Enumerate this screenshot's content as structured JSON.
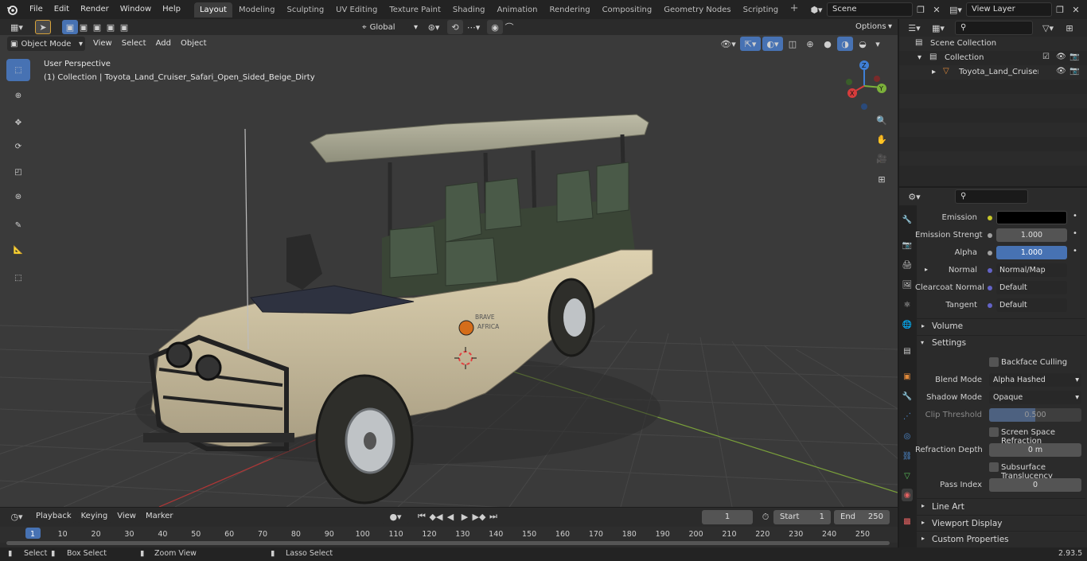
{
  "app": {
    "logo": "blender-logo-icon",
    "version": "2.93.5"
  },
  "menus": [
    "File",
    "Edit",
    "Render",
    "Window",
    "Help"
  ],
  "workspaces": [
    {
      "label": "Layout",
      "active": true
    },
    {
      "label": "Modeling"
    },
    {
      "label": "Sculpting"
    },
    {
      "label": "UV Editing"
    },
    {
      "label": "Texture Paint"
    },
    {
      "label": "Shading"
    },
    {
      "label": "Animation"
    },
    {
      "label": "Rendering"
    },
    {
      "label": "Compositing"
    },
    {
      "label": "Geometry Nodes"
    },
    {
      "label": "Scripting"
    }
  ],
  "scene": {
    "name": "Scene"
  },
  "view_layer": {
    "name": "View Layer"
  },
  "tool_header": {
    "transform_orientation": "Global",
    "options": "Options"
  },
  "viewport_header": {
    "mode": "Object Mode",
    "menus": [
      "View",
      "Select",
      "Add",
      "Object"
    ]
  },
  "viewport": {
    "perspective": "User Perspective",
    "collection_info": "(1) Collection | Toyota_Land_Cruiser_Safari_Open_Sided_Beige_Dirty",
    "vehicle_decal": [
      "BRAVE",
      "AFRICA"
    ],
    "gizmo": {
      "x": "X",
      "y": "Y",
      "z": "Z"
    }
  },
  "outliner": {
    "root": "Scene Collection",
    "collection": "Collection",
    "object": "Toyota_Land_Cruiser_Safa"
  },
  "properties": {
    "emission_label": "Emission",
    "emission_strength_label": "Emission Strengt",
    "emission_strength": "1.000",
    "alpha_label": "Alpha",
    "alpha": "1.000",
    "normal_label": "Normal",
    "normal": "Normal/Map",
    "clearcoat_label": "Clearcoat Normal",
    "clearcoat": "Default",
    "tangent_label": "Tangent",
    "tangent": "Default",
    "volume": "Volume",
    "settings": "Settings",
    "backface": "Backface Culling",
    "blend_label": "Blend Mode",
    "blend": "Alpha Hashed",
    "shadow_label": "Shadow Mode",
    "shadow": "Opaque",
    "clip_label": "Clip Threshold",
    "clip": "0.500",
    "ssr": "Screen Space Refraction",
    "refr_label": "Refraction Depth",
    "refr": "0 m",
    "sst": "Subsurface Translucency",
    "pass_label": "Pass Index",
    "pass": "0",
    "line_art": "Line Art",
    "viewport_display": "Viewport Display",
    "custom_props": "Custom Properties"
  },
  "timeline": {
    "menus": [
      "Playback",
      "Keying",
      "View",
      "Marker"
    ],
    "current": "1",
    "start_label": "Start",
    "start": "1",
    "end_label": "End",
    "end": "250",
    "ticks": [
      "1",
      "10",
      "20",
      "30",
      "40",
      "50",
      "60",
      "70",
      "80",
      "90",
      "100",
      "110",
      "120",
      "130",
      "140",
      "150",
      "160",
      "170",
      "180",
      "190",
      "200",
      "210",
      "220",
      "230",
      "240",
      "250"
    ]
  },
  "status": {
    "select": "Select",
    "box_select": "Box Select",
    "zoom_view": "Zoom View",
    "lasso_select": "Lasso Select"
  },
  "colors": {
    "accent": "#4772b3",
    "bg": "#3a3a3a",
    "panel": "#2b2b2b",
    "x_axis": "#d63c3c",
    "y_axis": "#7bb03a",
    "z_axis": "#3f7fd6"
  }
}
